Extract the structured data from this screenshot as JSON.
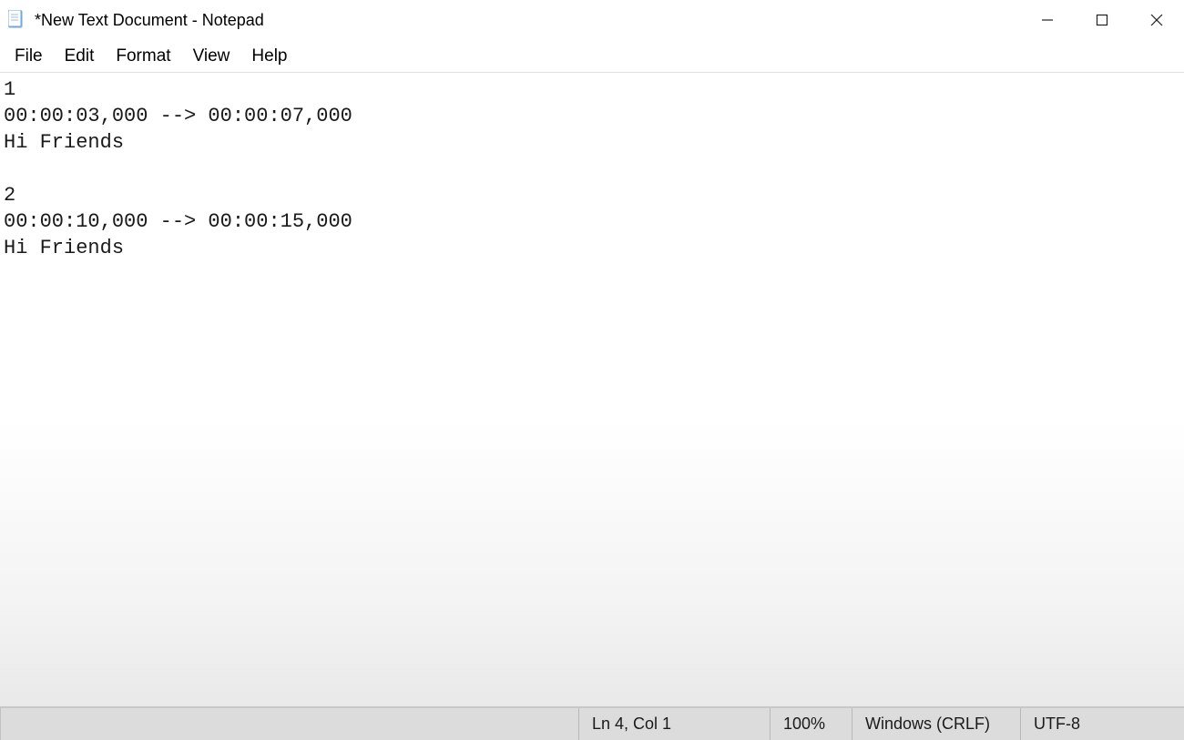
{
  "window": {
    "title": "*New Text Document - Notepad"
  },
  "menu": {
    "file": "File",
    "edit": "Edit",
    "format": "Format",
    "view": "View",
    "help": "Help"
  },
  "document": {
    "text": "1\n00:00:03,000 --> 00:00:07,000\nHi Friends\n\n2\n00:00:10,000 --> 00:00:15,000\nHi Friends"
  },
  "statusbar": {
    "position": "Ln 4, Col 1",
    "zoom": "100%",
    "line_ending": "Windows (CRLF)",
    "encoding": "UTF-8"
  }
}
